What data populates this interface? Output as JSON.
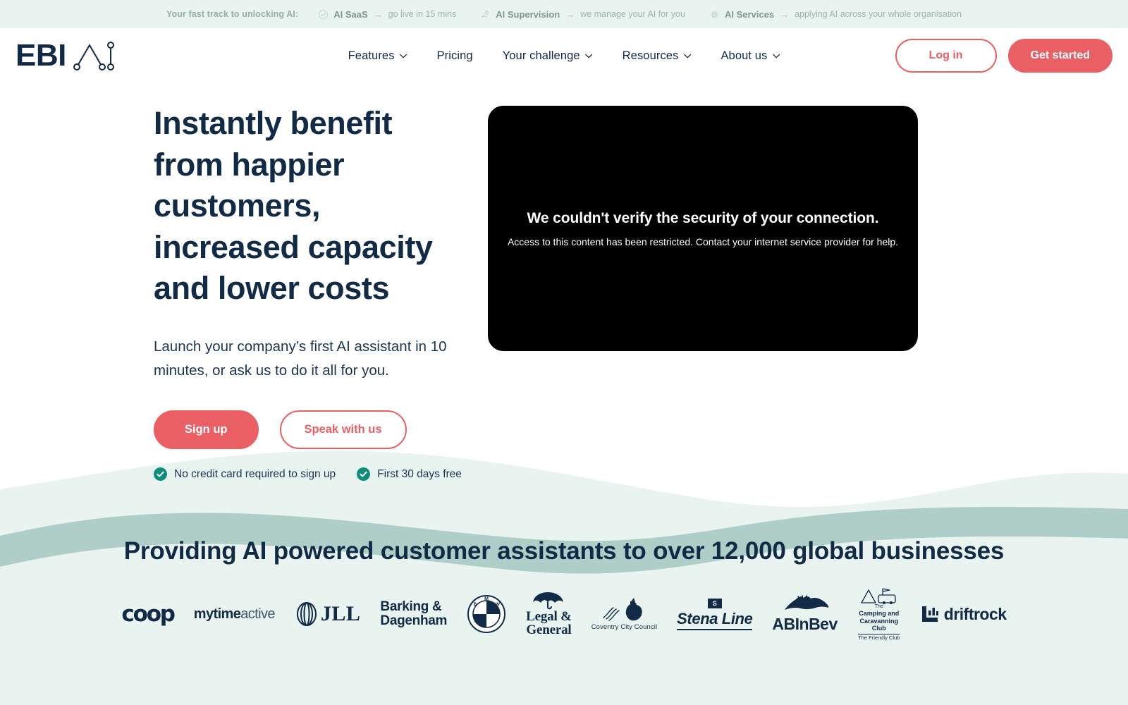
{
  "topbar": {
    "lead": "Your fast track to unlocking AI:",
    "items": [
      {
        "icon": "check-circle-icon",
        "label": "AI SaaS",
        "arrow": "→",
        "tail": "go live in 15 mins"
      },
      {
        "icon": "hand-gear-icon",
        "label": "AI Supervision",
        "arrow": "→",
        "tail": "we manage your AI for you"
      },
      {
        "icon": "chip-icon",
        "label": "AI Services",
        "arrow": "→",
        "tail": "applying AI across your whole organisation"
      }
    ]
  },
  "header": {
    "logo_text": "EBI",
    "logo_mark": "ai-nodes-icon",
    "nav": [
      {
        "label": "Features",
        "has_caret": true
      },
      {
        "label": "Pricing",
        "has_caret": false
      },
      {
        "label": "Your challenge",
        "has_caret": true
      },
      {
        "label": "Resources",
        "has_caret": true
      },
      {
        "label": "About us",
        "has_caret": true
      }
    ],
    "login_label": "Log in",
    "get_started_label": "Get started"
  },
  "hero": {
    "title": "Instantly benefit from happier customers, increased capacity and lower costs",
    "subtitle": "Launch your company’s first AI assistant in 10 minutes, or ask us to do it all for you.",
    "primary_cta": "Sign up",
    "secondary_cta": "Speak with us",
    "assurances": [
      "No credit card required to sign up",
      "First 30 days free"
    ],
    "video": {
      "title": "We couldn't verify the security of your connection.",
      "subtitle": "Access to this content has been restricted. Contact your internet service provider for help."
    }
  },
  "clients": {
    "title": "Providing AI powered customer assistants to over 12,000 global businesses",
    "logos": [
      {
        "name": "coop",
        "text": "coop"
      },
      {
        "name": "mytimeactive",
        "bold": "mytime",
        "light": "active"
      },
      {
        "name": "jll",
        "text": "JLL"
      },
      {
        "name": "barking-dagenham",
        "line1": "Barking &",
        "line2": "Dagenham"
      },
      {
        "name": "bmw",
        "text": "BMW"
      },
      {
        "name": "legal-and-general",
        "line1": "Legal &",
        "line2": "General"
      },
      {
        "name": "coventry-city-council",
        "text": "Coventry City Council"
      },
      {
        "name": "stena-line",
        "badge": "S",
        "text": "Stena Line"
      },
      {
        "name": "abinbev",
        "text": "ABInBev"
      },
      {
        "name": "camping-and-caravanning-club",
        "line0": "The",
        "line1": "Camping and",
        "line2": "Caravanning",
        "line3": "Club",
        "line4": "The Friendly Club"
      },
      {
        "name": "driftrock",
        "text": "driftrock"
      }
    ]
  },
  "colors": {
    "accent": "#EA5F64",
    "navy": "#112A46",
    "mint": "#E9F3F0",
    "teal_wave": "#A9CBC4",
    "tick_green": "#0E8E79",
    "video_bg": "#000000"
  }
}
